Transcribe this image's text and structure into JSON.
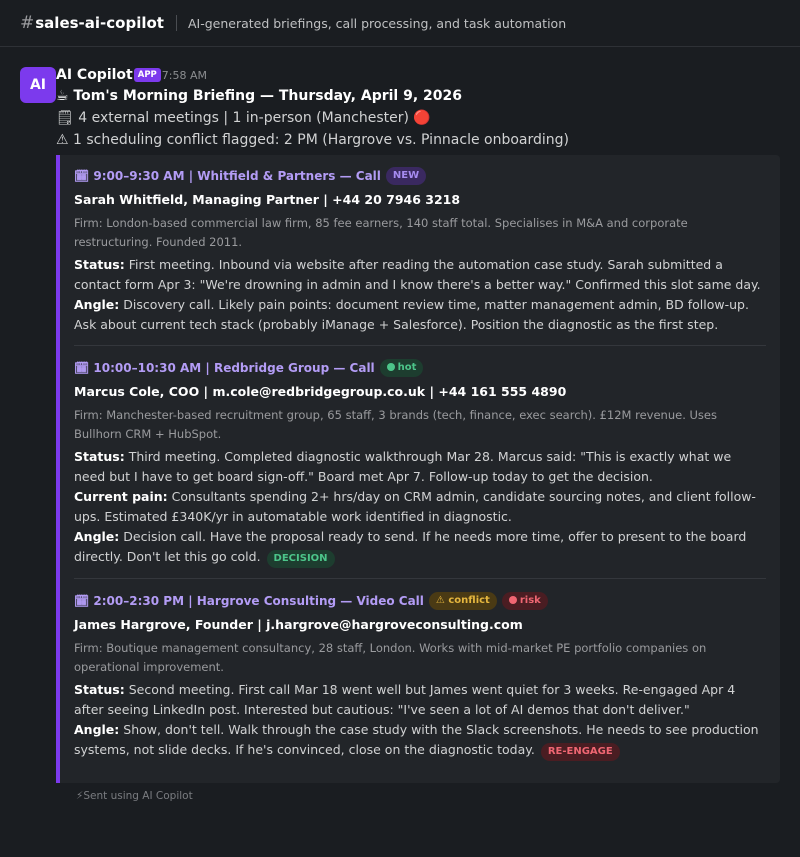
{
  "header": {
    "hash": "#",
    "channel": "sales-ai-copilot",
    "topic": "AI-generated briefings, call processing, and task automation"
  },
  "message": {
    "avatar_text": "AI",
    "sender": "AI Copilot",
    "badge": "APP",
    "time": "7:58 AM",
    "title": "☕ Tom's Morning Briefing — Thursday, April 9, 2026",
    "summary": "🗒 4 external meetings | 1 in-person (Manchester) 🔴",
    "conflict_line": "⚠ 1 scheduling conflict flagged: 2 PM (Hargrove vs. Pinnacle onboarding)"
  },
  "meetings": [
    {
      "heading": "🗓 9:00–9:30 AM | Whitfield & Partners — Call",
      "tags": [
        "NEW"
      ],
      "contact": "Sarah Whitfield, Managing Partner | +44 20 7946 3218",
      "firm": "Firm: London-based commercial law firm, 85 fee earners, 140 staff total. Specialises in M&A and corporate restructuring. Founded 2011.",
      "status_label": "Status:",
      "status": "First meeting. Inbound via website after reading the automation case study. Sarah submitted a contact form Apr 3: \"We're drowning in admin and I know there's a better way.\" Confirmed this slot same day.",
      "angle_label": "Angle:",
      "angle": "Discovery call. Likely pain points: document review time, matter management admin, BD follow-up. Ask about current tech stack (probably iManage + Salesforce). Position the diagnostic as the first step."
    },
    {
      "heading": "🗓 10:00–10:30 AM | Redbridge Group — Call",
      "tags": [
        "hot"
      ],
      "contact": "Marcus Cole, COO | m.cole@redbridgegroup.co.uk | +44 161 555 4890",
      "firm": "Firm: Manchester-based recruitment group, 65 staff, 3 brands (tech, finance, exec search). £12M revenue. Uses Bullhorn CRM + HubSpot.",
      "status_label": "Status:",
      "status": "Third meeting. Completed diagnostic walkthrough Mar 28. Marcus said: \"This is exactly what we need but I have to get board sign-off.\" Board met Apr 7. Follow-up today to get the decision.",
      "pain_label": "Current pain:",
      "pain": "Consultants spending 2+ hrs/day on CRM admin, candidate sourcing notes, and client follow-ups. Estimated £340K/yr in automatable work identified in diagnostic.",
      "angle_label": "Angle:",
      "angle": "Decision call. Have the proposal ready to send. If he needs more time, offer to present to the board directly. Don't let this go cold.",
      "end_tag": "DECISION"
    },
    {
      "heading": "🗓 2:00–2:30 PM | Hargrove Consulting — Video Call",
      "tags": [
        "⚠ conflict",
        "risk"
      ],
      "contact": "James Hargrove, Founder | j.hargrove@hargroveconsulting.com",
      "firm": "Firm: Boutique management consultancy, 28 staff, London. Works with mid-market PE portfolio companies on operational improvement.",
      "status_label": "Status:",
      "status": "Second meeting. First call Mar 18 went well but James went quiet for 3 weeks. Re-engaged Apr 4 after seeing LinkedIn post. Interested but cautious: \"I've seen a lot of AI demos that don't deliver.\"",
      "angle_label": "Angle:",
      "angle": "Show, don't tell. Walk through the case study with the Slack screenshots. He needs to see production systems, not slide decks. If he's convinced, close on the diagnostic today.",
      "end_tag": "RE-ENGAGE"
    }
  ],
  "footer": "⚡Sent using AI Copilot"
}
